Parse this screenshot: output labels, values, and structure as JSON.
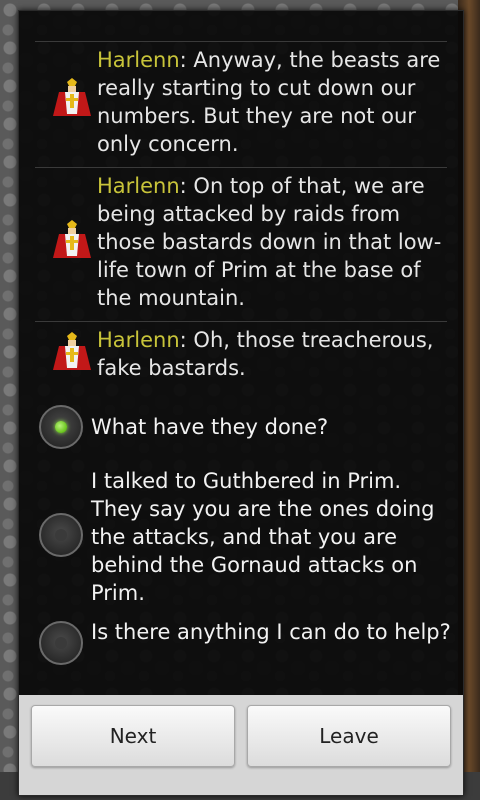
{
  "conversation": {
    "messages": [
      {
        "speaker": "Harlenn",
        "text": ": Anyway, the beasts are really starting to cut down our numbers. But they are not our only concern."
      },
      {
        "speaker": "Harlenn",
        "text": ": On top of that, we are being attacked by raids from those bastards down in that low-life town of Prim at the base of the mountain."
      },
      {
        "speaker": "Harlenn",
        "text": ": Oh, those treacherous, fake bastards."
      }
    ],
    "options": [
      {
        "label": "What have they done?",
        "selected": true
      },
      {
        "label": "I talked to Guthbered in Prim. They say you are the ones doing the attacks, and that you are behind the Gornaud attacks on Prim.",
        "selected": false
      },
      {
        "label": "Is there anything I can do to help?",
        "selected": false
      }
    ]
  },
  "buttons": {
    "next": "Next",
    "leave": "Leave"
  },
  "colors": {
    "speaker": "#c8c43a",
    "selected_radio": "#66c21a"
  },
  "icons": {
    "avatar": "knight-avatar-icon"
  }
}
